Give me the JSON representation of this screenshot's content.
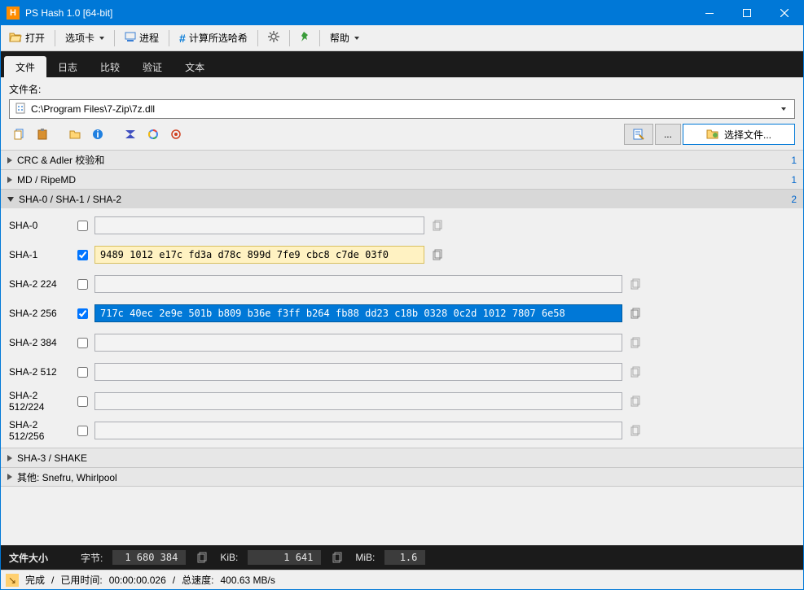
{
  "window": {
    "title": "PS Hash 1.0   [64-bit]"
  },
  "toolbar": {
    "open": "打开",
    "tabs": "选项卡",
    "process": "进程",
    "calc": "计算所选哈希",
    "help": "帮助"
  },
  "maintabs": {
    "file": "文件",
    "log": "日志",
    "compare": "比较",
    "verify": "验证",
    "text": "文本"
  },
  "file": {
    "label": "文件名:",
    "path": "C:\\Program Files\\7-Zip\\7z.dll",
    "choose": "选择文件...",
    "ellipsis": "..."
  },
  "sections": {
    "crc": {
      "name": "CRC & Adler 校验和",
      "count": "1"
    },
    "md": {
      "name": "MD / RipeMD",
      "count": "1"
    },
    "sha": {
      "name": "SHA-0 / SHA-1 / SHA-2",
      "count": "2"
    },
    "sha3": {
      "name": "SHA-3 / SHAKE"
    },
    "other": {
      "name": "其他: Snefru, Whirlpool"
    }
  },
  "hashes": {
    "sha0": {
      "label": "SHA-0",
      "value": ""
    },
    "sha1": {
      "label": "SHA-1",
      "value": "9489 1012 e17c fd3a d78c 899d 7fe9 cbc8 c7de 03f0"
    },
    "sha224": {
      "label": "SHA-2 224",
      "value": ""
    },
    "sha256": {
      "label": "SHA-2 256",
      "value": "717c 40ec 2e9e 501b b809 b36e f3ff b264 fb88 dd23 c18b 0328 0c2d 1012 7807 6e58"
    },
    "sha384": {
      "label": "SHA-2 384",
      "value": ""
    },
    "sha512": {
      "label": "SHA-2 512",
      "value": ""
    },
    "sha512_224": {
      "label": "SHA-2 512/224",
      "value": ""
    },
    "sha512_256": {
      "label": "SHA-2 512/256",
      "value": ""
    }
  },
  "size": {
    "label": "文件大小",
    "bytes_label": "字节:",
    "bytes": "1 680 384",
    "kib_label": "KiB:",
    "kib": "1 641",
    "mib_label": "MiB:",
    "mib": "1.6"
  },
  "status": {
    "done": "完成",
    "sep": "/",
    "elapsed_label": "已用时间:",
    "elapsed": "00:00:00.026",
    "speed_label": "总速度:",
    "speed": "400.63 MB/s"
  },
  "colors": {
    "accent": "#0078d7"
  }
}
